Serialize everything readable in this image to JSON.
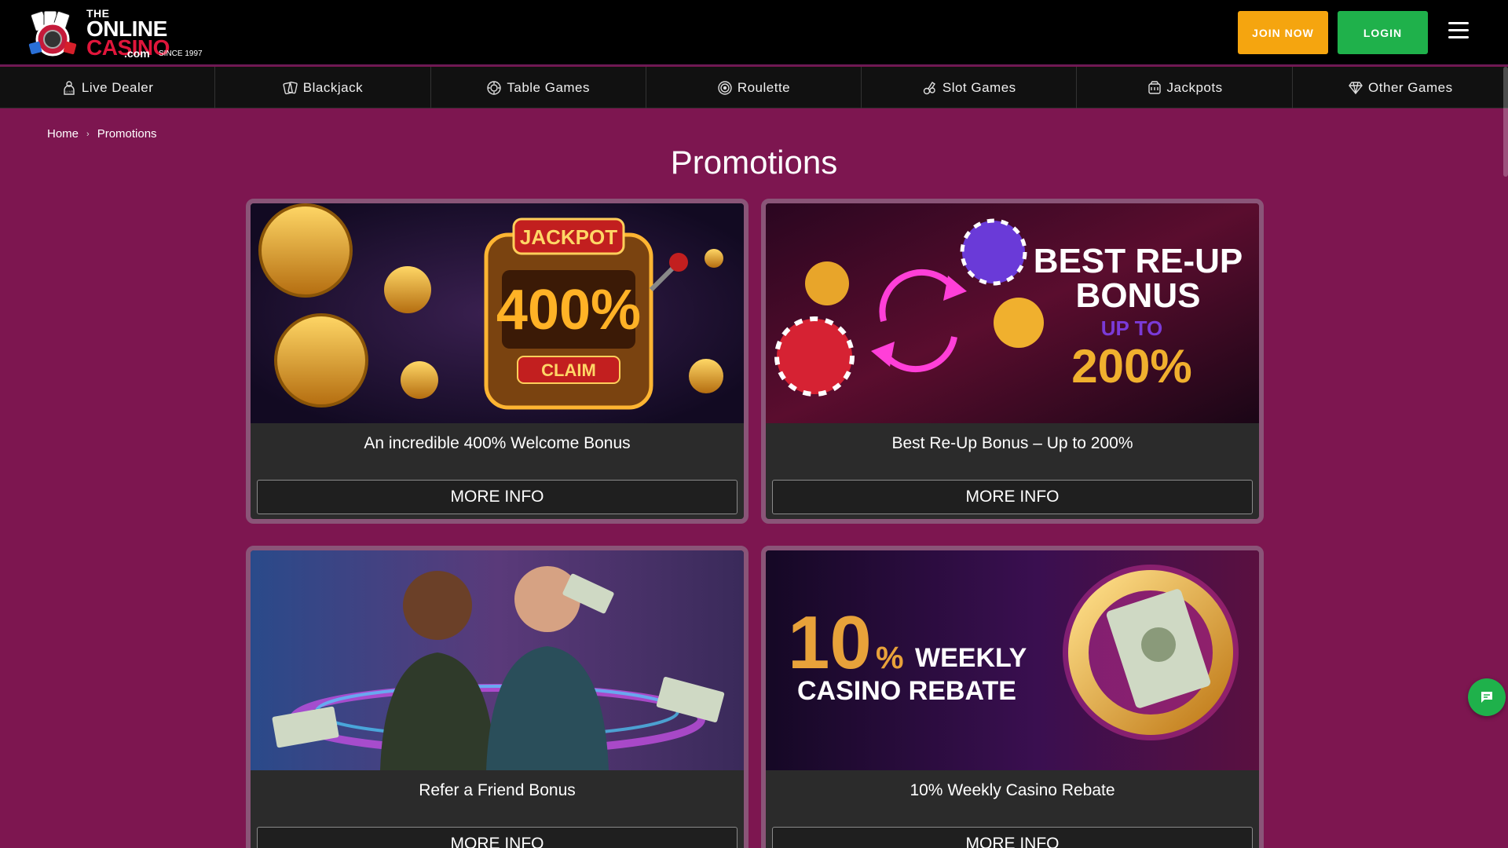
{
  "header": {
    "logo": {
      "the": "THE",
      "online": "ONLINE",
      "casino": "CASINO",
      "com": ".com",
      "since": "SINCE 1997"
    },
    "join_label": "JOIN NOW",
    "login_label": "LOGIN"
  },
  "nav": {
    "items": [
      {
        "label": "Live Dealer",
        "icon": "live-dealer-icon"
      },
      {
        "label": "Blackjack",
        "icon": "blackjack-icon"
      },
      {
        "label": "Table Games",
        "icon": "table-games-icon"
      },
      {
        "label": "Roulette",
        "icon": "roulette-icon"
      },
      {
        "label": "Slot Games",
        "icon": "slot-games-icon"
      },
      {
        "label": "Jackpots",
        "icon": "jackpots-icon"
      },
      {
        "label": "Other Games",
        "icon": "diamond-icon"
      }
    ]
  },
  "breadcrumb": {
    "home": "Home",
    "current": "Promotions"
  },
  "page": {
    "title": "Promotions"
  },
  "cards": [
    {
      "title": "An incredible 400% Welcome Bonus",
      "button": "MORE INFO",
      "image_text": {
        "jackpot": "JACKPOT",
        "percent": "400%",
        "claim": "CLAIM"
      }
    },
    {
      "title": "Best Re-Up Bonus – Up to 200%",
      "button": "MORE INFO",
      "image_text": {
        "line1": "BEST RE-UP",
        "line2": "BONUS",
        "upto": "UP TO",
        "percent": "200%"
      }
    },
    {
      "title": "Refer a Friend Bonus",
      "button": "MORE INFO"
    },
    {
      "title": "10% Weekly Casino Rebate",
      "button": "MORE INFO",
      "image_text": {
        "ten": "10",
        "pct": "%",
        "weekly": "WEEKLY",
        "rebate": "CASINO REBATE"
      }
    }
  ],
  "colors": {
    "background": "#7d1650",
    "join": "#f5a50f",
    "login": "#1fb14b",
    "card_border": "#8a5578"
  }
}
